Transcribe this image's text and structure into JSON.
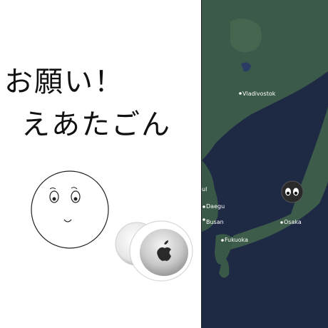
{
  "title": {
    "line1": "お願い！",
    "line2": "えあたごん"
  },
  "map": {
    "cities": [
      "Vladivostok",
      "ul",
      "Daegu",
      "Busan",
      "Fukuoka",
      "Osaka"
    ],
    "colors": {
      "sea": "#1e2a44",
      "land": "#3c5a4a",
      "land_dark": "#2f4a3c"
    }
  },
  "icons": [
    "smiley-face-icon",
    "airtag-icon",
    "eyes-marker-icon",
    "city-dot-icon"
  ]
}
